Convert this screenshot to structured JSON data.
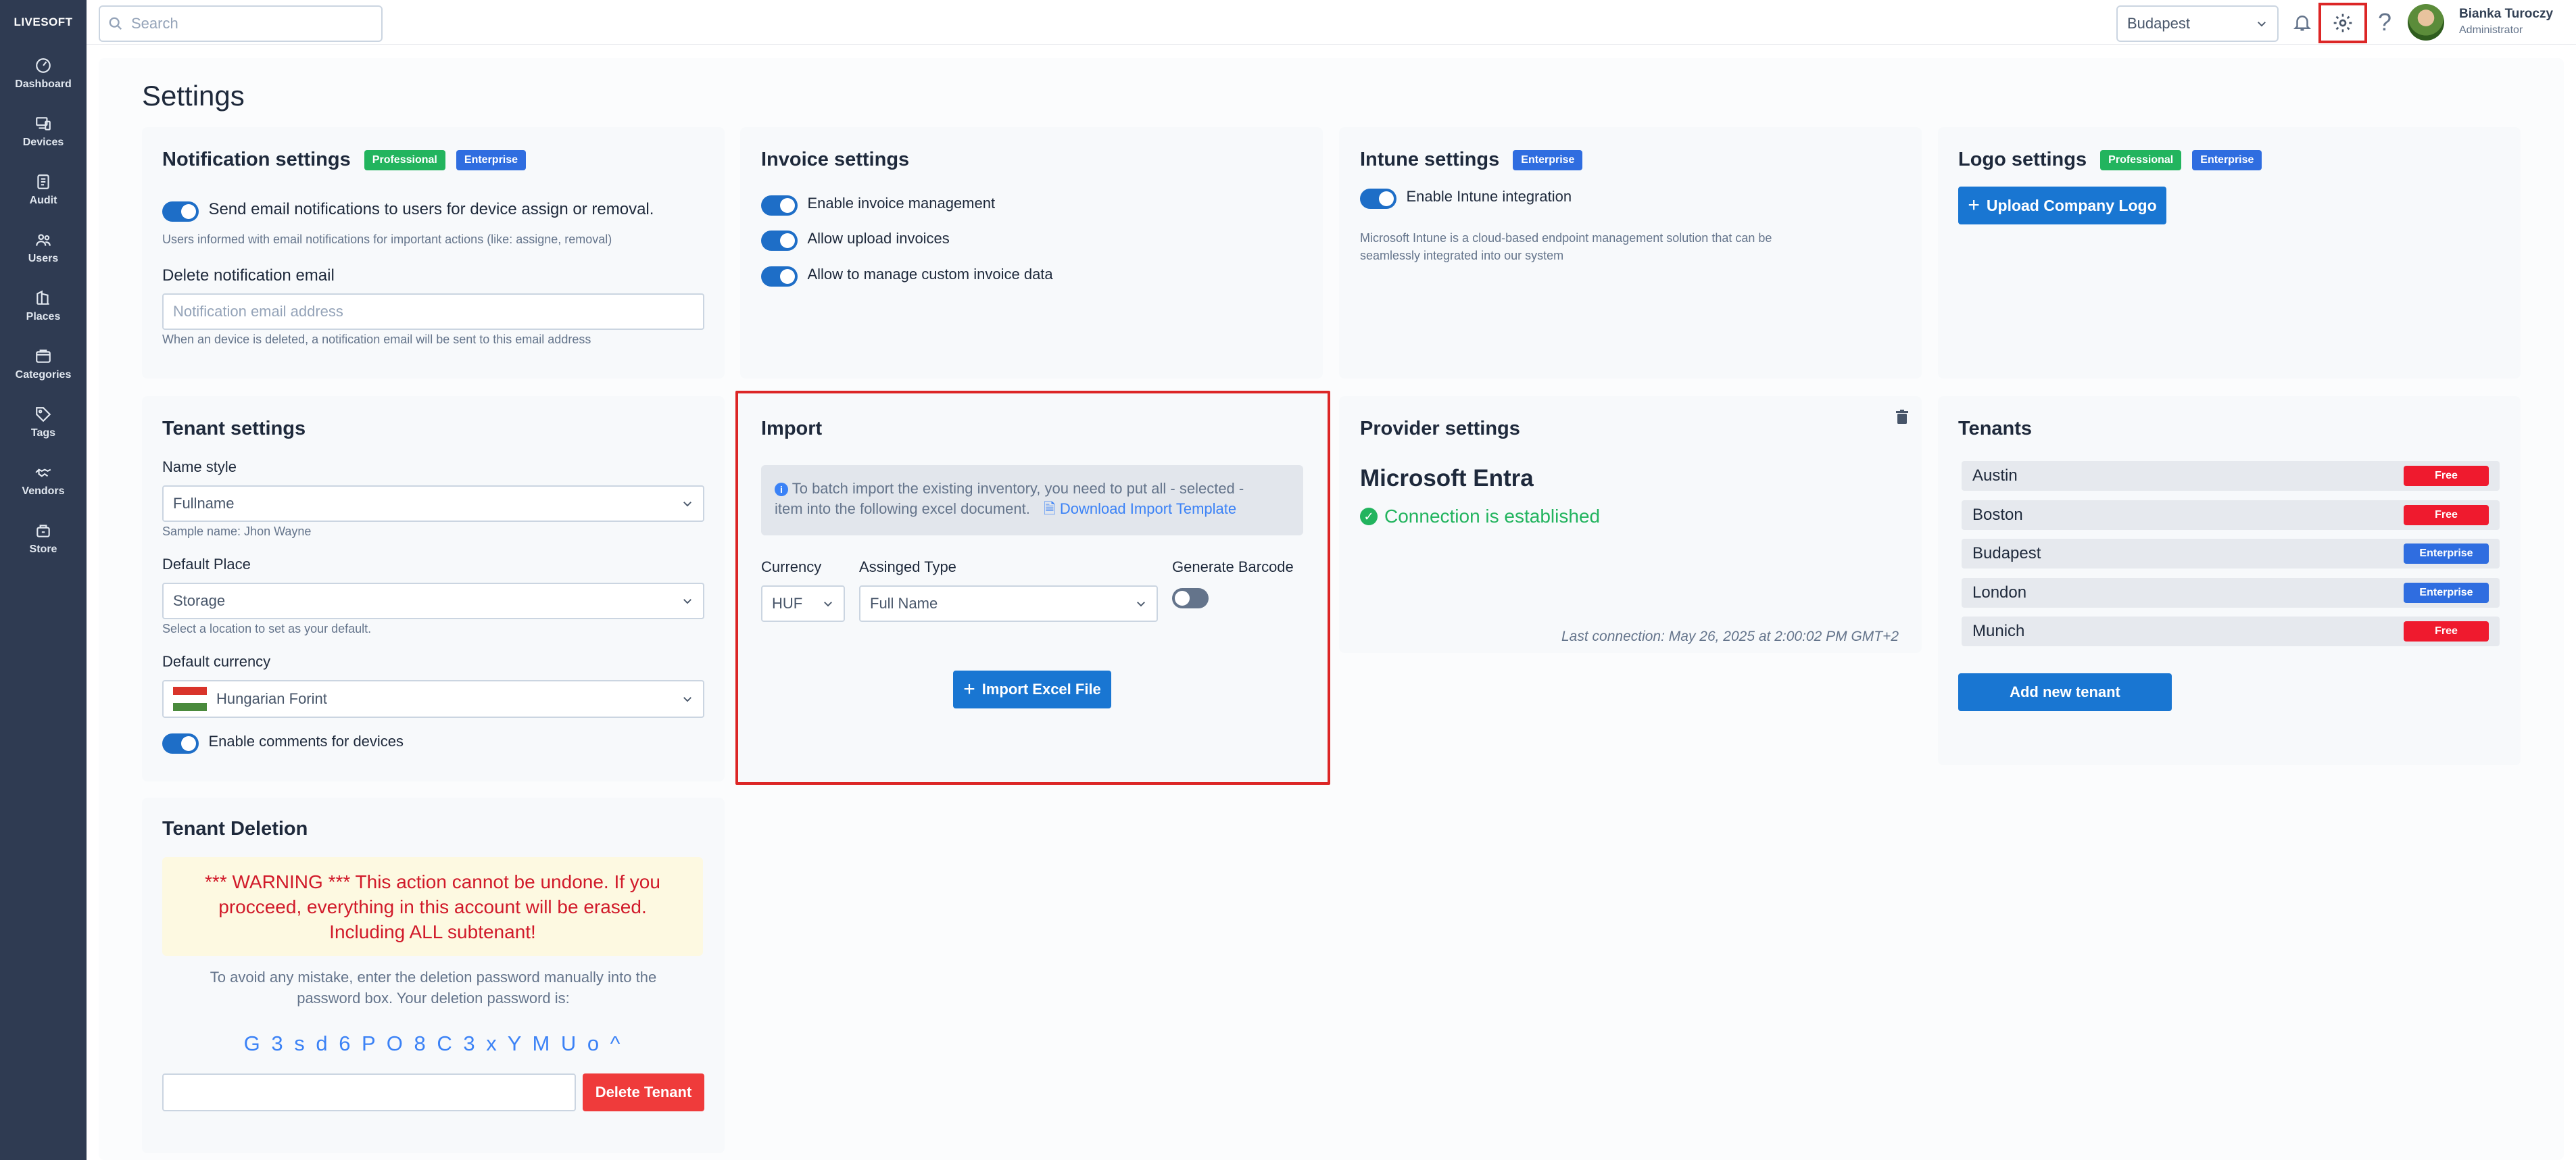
{
  "brand": "LIVESOFT",
  "nav": [
    {
      "label": "Dashboard",
      "icon": "dashboard-icon"
    },
    {
      "label": "Devices",
      "icon": "devices-icon"
    },
    {
      "label": "Audit",
      "icon": "audit-icon"
    },
    {
      "label": "Users",
      "icon": "users-icon"
    },
    {
      "label": "Places",
      "icon": "places-icon"
    },
    {
      "label": "Categories",
      "icon": "categories-icon"
    },
    {
      "label": "Tags",
      "icon": "tag-icon"
    },
    {
      "label": "Vendors",
      "icon": "vendors-icon"
    },
    {
      "label": "Store",
      "icon": "store-icon"
    }
  ],
  "topbar": {
    "search_placeholder": "Search",
    "location": "Budapest",
    "help": "?",
    "user_name": "Bianka Turoczy",
    "user_role": "Administrator"
  },
  "page_title": "Settings",
  "notification": {
    "title": "Notification settings",
    "badges": [
      "Professional",
      "Enterprise"
    ],
    "toggle_label": "Send email notifications to users for device assign or removal.",
    "toggle_on": true,
    "hint": "Users informed with email notifications for important actions (like: assigne, removal)",
    "email_label": "Delete notification email",
    "email_placeholder": "Notification email address",
    "email_hint": "When an device is deleted, a notification email will be sent to this email address"
  },
  "invoice": {
    "title": "Invoice settings",
    "options": [
      "Enable invoice management",
      "Allow upload invoices",
      "Allow to manage custom invoice data"
    ]
  },
  "intune": {
    "title": "Intune settings",
    "badge": "Enterprise",
    "toggle_label": "Enable Intune integration",
    "description_line1": "Microsoft Intune is a cloud-based endpoint management solution that can be",
    "description_line2": "seamlessly integrated into our system"
  },
  "logo": {
    "title": "Logo settings",
    "badges": [
      "Professional",
      "Enterprise"
    ],
    "upload_button": "Upload Company Logo"
  },
  "tenant_settings": {
    "title": "Tenant settings",
    "name_style_label": "Name style",
    "name_style_value": "Fullname",
    "name_style_hint": "Sample name: Jhon Wayne",
    "default_place_label": "Default Place",
    "default_place_value": "Storage",
    "default_place_hint": "Select a location to set as your default.",
    "currency_label": "Default currency",
    "currency_value": "Hungarian Forint",
    "comments_label": "Enable comments for devices"
  },
  "import": {
    "title": "Import",
    "info_line1": "To batch import the existing inventory, you need to put all - selected -",
    "info_line2": "item into the following excel document.",
    "template_link": "Download Import Template",
    "currency_label": "Currency",
    "currency_value": "HUF",
    "assigned_label": "Assinged Type",
    "assigned_value": "Full Name",
    "barcode_label": "Generate Barcode",
    "import_button": "Import Excel File"
  },
  "provider": {
    "title": "Provider settings",
    "provider_name": "Microsoft Entra",
    "status": "Connection is established",
    "last_connection": "Last connection: May 26, 2025 at 2:00:02 PM GMT+2"
  },
  "tenants": {
    "title": "Tenants",
    "list": [
      {
        "name": "Austin",
        "plan": "Free"
      },
      {
        "name": "Boston",
        "plan": "Free"
      },
      {
        "name": "Budapest",
        "plan": "Enterprise"
      },
      {
        "name": "London",
        "plan": "Enterprise"
      },
      {
        "name": "Munich",
        "plan": "Free"
      }
    ],
    "add_button": "Add new tenant"
  },
  "deletion": {
    "title": "Tenant Deletion",
    "warning_line1": "*** WARNING *** This action cannot be undone. If you",
    "warning_line2": "procceed, everything in this account will be erased.",
    "warning_line3": "Including ALL subtenant!",
    "instruction_line1": "To avoid any mistake, enter the deletion password manually into the",
    "instruction_line2": "password box. Your deletion password is:",
    "password": "G 3 s d 6 P O 8 C 3 x Y M U o ^",
    "delete_button": "Delete Tenant"
  },
  "colors": {
    "sidebar": "#2f3b52",
    "primary": "#1976d2",
    "danger": "#ef3b3b",
    "success": "#22b45e",
    "enterprise": "#2f6de0",
    "free": "#ef1a2e",
    "highlight": "#dc2626"
  }
}
